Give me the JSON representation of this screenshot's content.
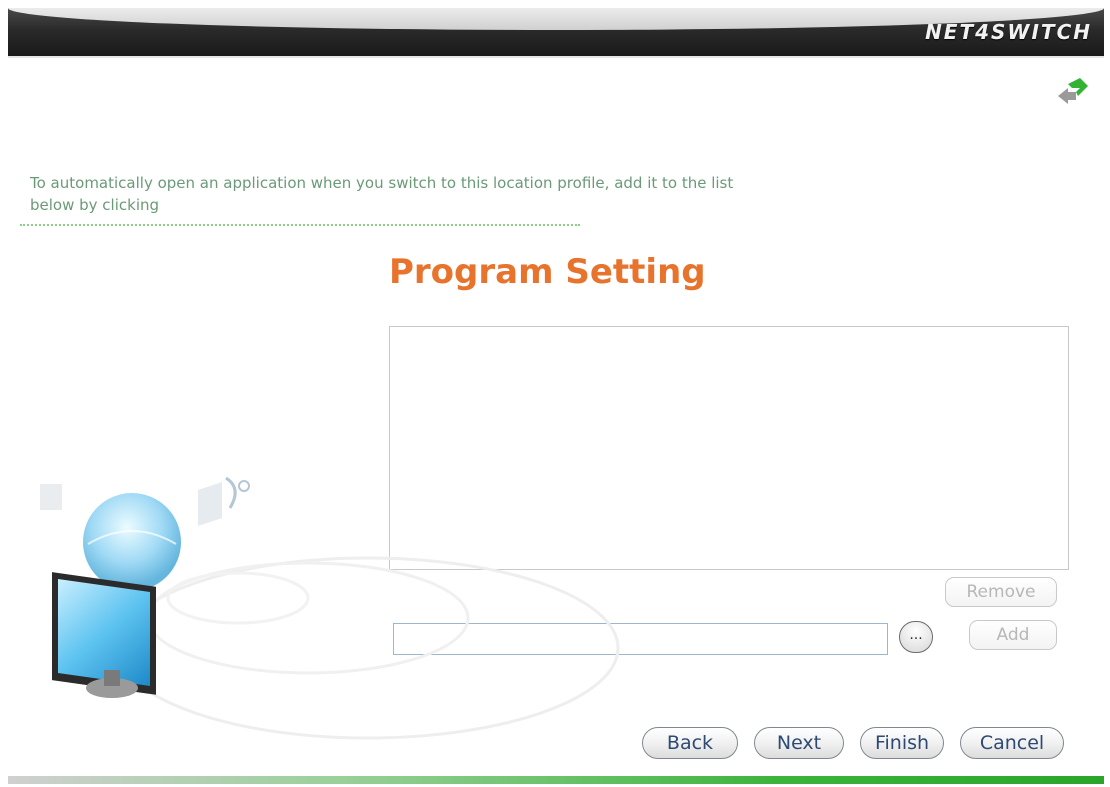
{
  "window": {
    "brand": "NET4SWITCH"
  },
  "instruction_text": "To automatically open an application when you switch to this location profile, add it to the list below by clicking",
  "page_title": "Program Setting",
  "program_list": {
    "items": []
  },
  "buttons": {
    "remove": "Remove",
    "add": "Add",
    "browse": "...",
    "back": "Back",
    "next": "Next",
    "finish": "Finish",
    "cancel": "Cancel"
  },
  "path_input": {
    "value": ""
  },
  "colors": {
    "title": "#e8732c",
    "instruction": "#6b9a78",
    "button_text": "#2c4a74",
    "accent_green": "#3cb43c"
  },
  "icons": {
    "logo": "switch-arrows-icon",
    "art": "network-computer-illustration"
  }
}
